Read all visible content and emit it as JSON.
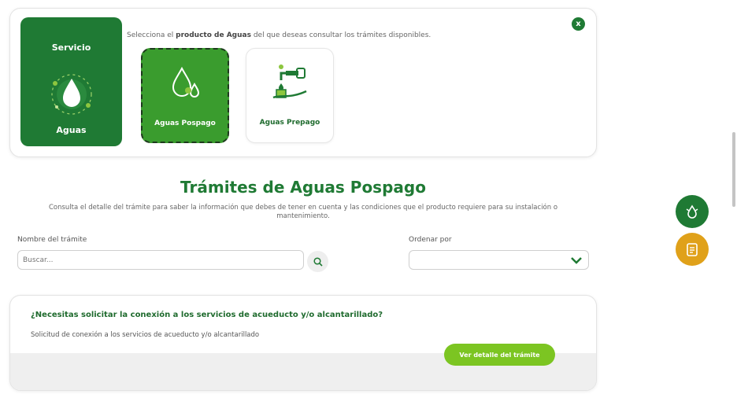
{
  "service": {
    "heading": "Servicio",
    "name": "Aguas"
  },
  "selector": {
    "intro_prefix": "Selecciona el ",
    "intro_bold": "producto de Aguas",
    "intro_suffix": " del que deseas consultar los trámites disponibles.",
    "close_label": "x",
    "options": [
      {
        "label": "Aguas Pospago",
        "selected": true
      },
      {
        "label": "Aguas Prepago",
        "selected": false
      }
    ]
  },
  "page": {
    "title": "Trámites de Aguas Pospago",
    "subtitle": "Consulta el detalle del trámite para saber la información que debes de tener en cuenta y las condiciones que el producto requiere para su instalación o mantenimiento."
  },
  "filters": {
    "name_label": "Nombre del trámite",
    "search_placeholder": "Buscar...",
    "sort_label": "Ordenar por",
    "sort_value": ""
  },
  "procedure": {
    "title": "¿Necesitas solicitar la conexión a los servicios de acueducto y/o alcantarillado?",
    "description": "Solicitud de conexión a los servicios de acueducto y/o alcantarillado",
    "button_label": "Ver detalle del trámite"
  },
  "colors": {
    "brand_green": "#1f7a34",
    "selected_green": "#3a9c2e",
    "lime": "#7cc522",
    "orange": "#e0a11a"
  },
  "icons": {
    "service": "water-drop-icon",
    "pospago": "water-drops-icon",
    "prepago": "faucet-hand-icon",
    "search": "search-icon",
    "sort": "chevron-down-icon",
    "fab_top": "water-leak-icon",
    "fab_bottom": "clipboard-icon"
  }
}
